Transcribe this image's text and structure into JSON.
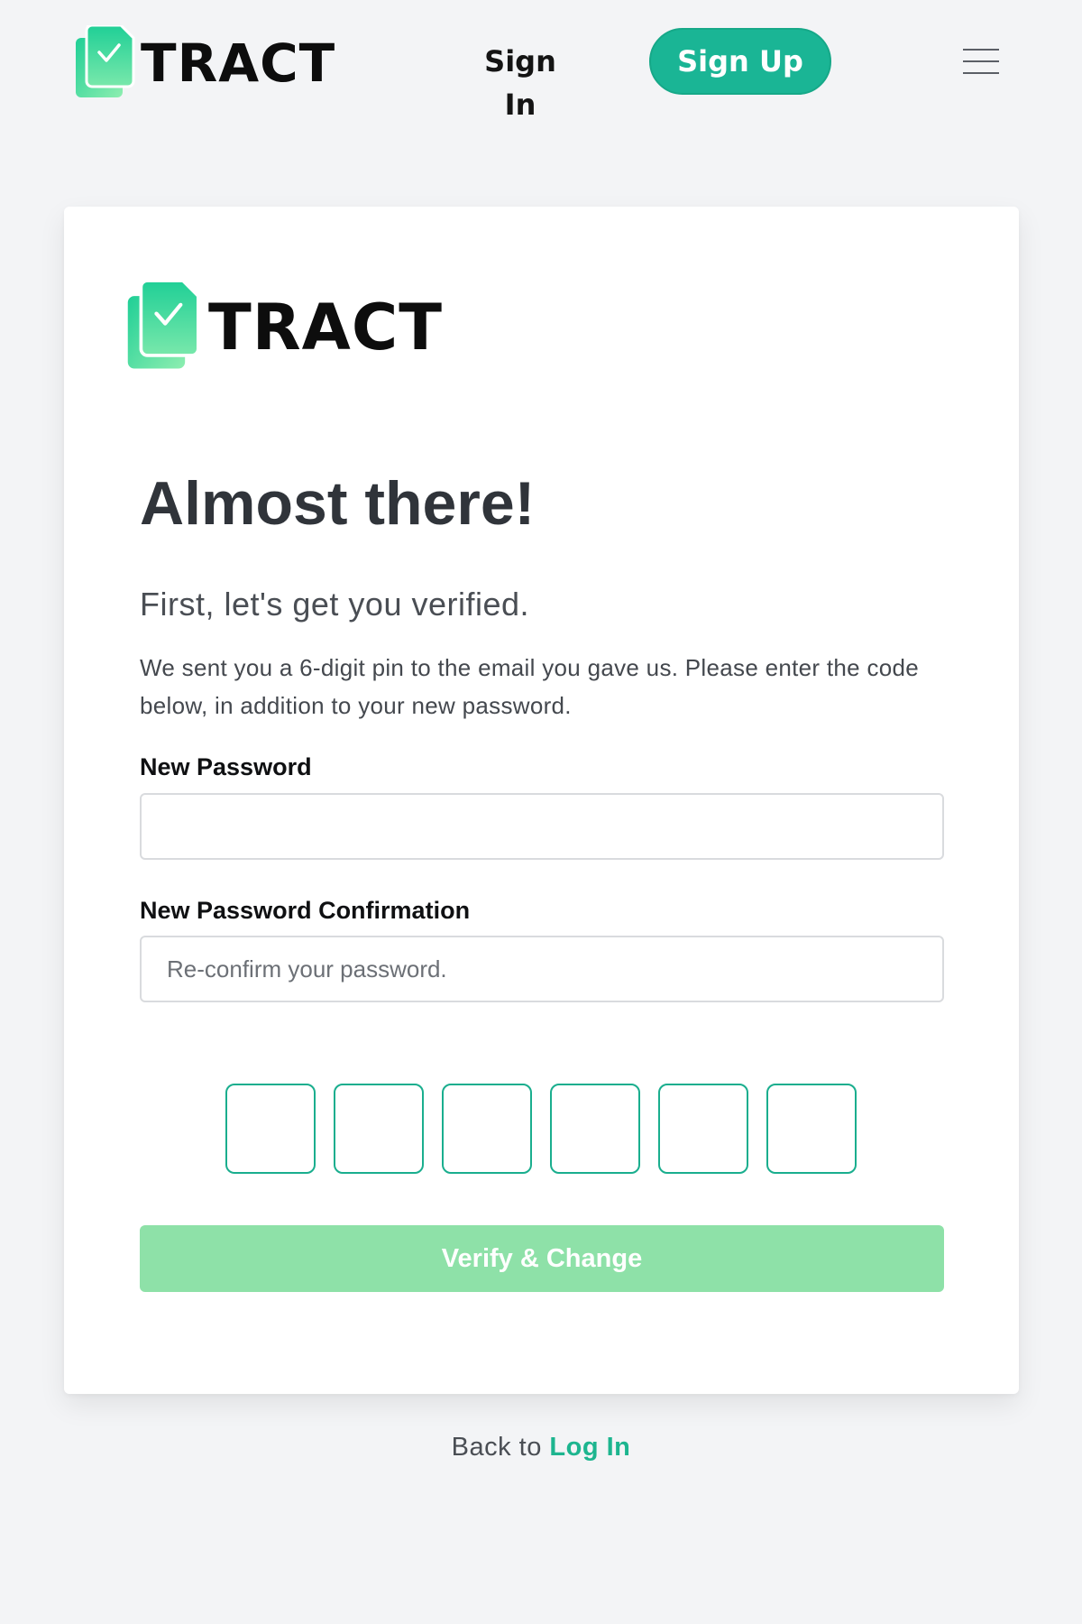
{
  "brand": {
    "name": "TRACT",
    "icon": "document-check-icon",
    "accent_color": "#1ab595",
    "icon_gradient": [
      "#1fd39a",
      "#8ef0b0"
    ]
  },
  "header": {
    "sign_in_label": "Sign In",
    "sign_up_label": "Sign Up",
    "menu_icon": "hamburger-menu-icon"
  },
  "card": {
    "title": "Almost there!",
    "subtitle": "First, let's get you verified.",
    "description": "We sent you a 6-digit pin to the email you gave us. Please enter the code below, in addition to your new password.",
    "new_password": {
      "label": "New Password",
      "value": "",
      "placeholder": ""
    },
    "password_confirmation": {
      "label": "New Password Confirmation",
      "value": "",
      "placeholder": "Re-confirm your password."
    },
    "pin": {
      "digits": [
        "",
        "",
        "",
        "",
        "",
        ""
      ],
      "border_color": "#1aae8e"
    },
    "submit": {
      "label": "Verify & Change",
      "color": "#8ee1a8"
    }
  },
  "footer": {
    "prefix": "Back to",
    "link_label": "Log In"
  }
}
